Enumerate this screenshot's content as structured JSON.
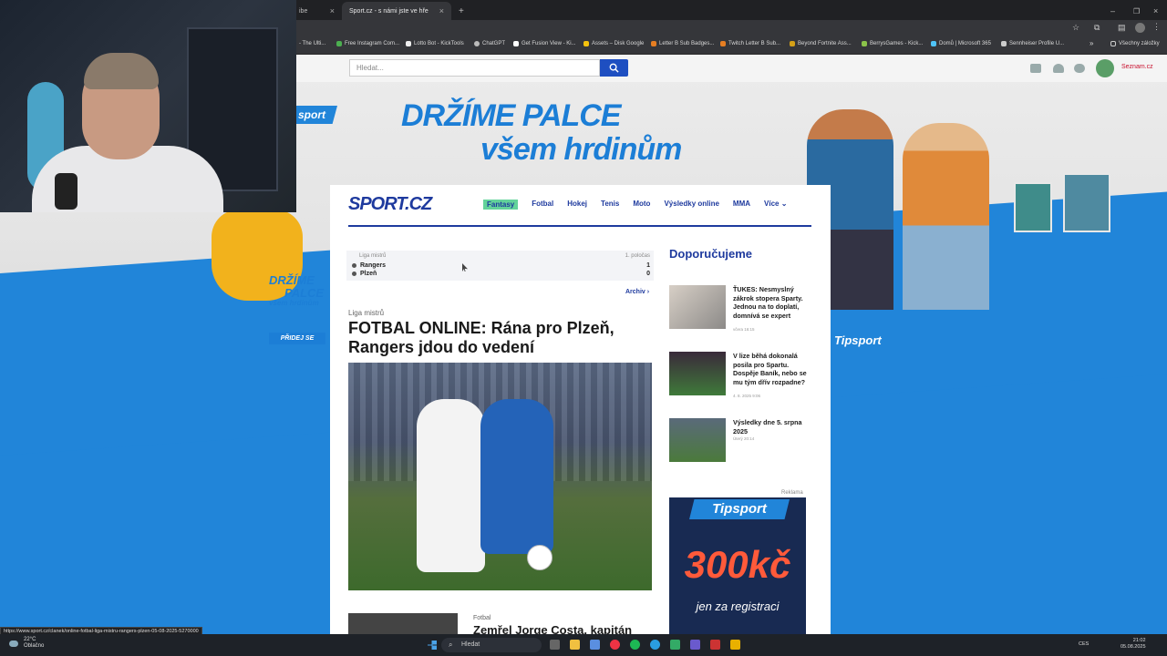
{
  "browser": {
    "tabs": [
      {
        "label": "ibe",
        "active": false
      },
      {
        "label": "Sport.cz - s námi jste ve hře",
        "active": true
      }
    ],
    "new_tab": "+",
    "bookmarks": [
      "- The Ulti...",
      "Free Instagram Com...",
      "Lotto Bot - KickTools",
      "ChatGPT",
      "Get Fusion View - Ki...",
      "Assets – Disk Google",
      "Letter B Sub Badges...",
      "Twitch Letter B Sub...",
      "Beyond Fortnite Ass...",
      "BerrysGames - Kick...",
      "Domů | Microsoft 365",
      "Sennheiser Profile U..."
    ],
    "bookmarks_more": "»",
    "all_bookmarks": "Všechny záložky",
    "status_url": "https://www.sport.cz/clanek/online-fotbal-liga-mistru-rangers-plzen-05-08-2025-5270000"
  },
  "header": {
    "search_placeholder": "Hledat...",
    "seznam_label": "Seznam.cz"
  },
  "ad": {
    "brand": "sport",
    "headline_line1": "DRŽÍME PALCE",
    "headline_line2": "všem hrdinům",
    "small_line1": "DRŽÍME",
    "small_line2": "PALCE",
    "small_line3": "všem hrdinům",
    "join_button": "PŘIDEJ SE",
    "sponsor": "Tipsport"
  },
  "site": {
    "logo": "SPORT.CZ",
    "nav": [
      "Fantasy",
      "Fotbal",
      "Hokej",
      "Tenis",
      "Moto",
      "Výsledky online",
      "MMA",
      "Více ⌄"
    ]
  },
  "score": {
    "league": "Liga mistrů",
    "period": "1. poločas",
    "home": "Rangers",
    "home_score": "1",
    "away": "Plzeň",
    "away_score": "0",
    "archive": "Archiv ›"
  },
  "article": {
    "category": "Liga mistrů",
    "title": "FOTBAL ONLINE: Rána pro Plzeň, Rangers jdou do vedení"
  },
  "second_article": {
    "category": "Fotbal",
    "title": "Zemřel Jorge Costa, kapitán"
  },
  "recommend": {
    "heading": "Doporučujeme",
    "items": [
      {
        "title": "ŤUKES: Nesmyslný zákrok stopera Sparty. Jednou na to doplatí, domnívá se expert",
        "date": "včera 16:15"
      },
      {
        "title": "V lize běhá dokonalá posila pro Spartu. Dospěje Baník, nebo se mu tým dřív rozpadne?",
        "date": "4. 8. 2025 9:06"
      },
      {
        "title": "Výsledky dne 5. srpna 2025",
        "date": "Úterý 20:14"
      }
    ],
    "ad_label": "Reklama",
    "ad_brand": "Tipsport",
    "ad_amount": "300kč",
    "ad_sub": "jen za registraci"
  },
  "taskbar": {
    "temp": "22°C",
    "weather": "Oblačno",
    "search": "Hledat",
    "lang": "CES",
    "time": "21:02",
    "date": "05.08.2025"
  },
  "colors": {
    "brand_blue": "#1e3a9e",
    "page_blue": "#2185d9",
    "fantasy_green": "#63d39a"
  }
}
